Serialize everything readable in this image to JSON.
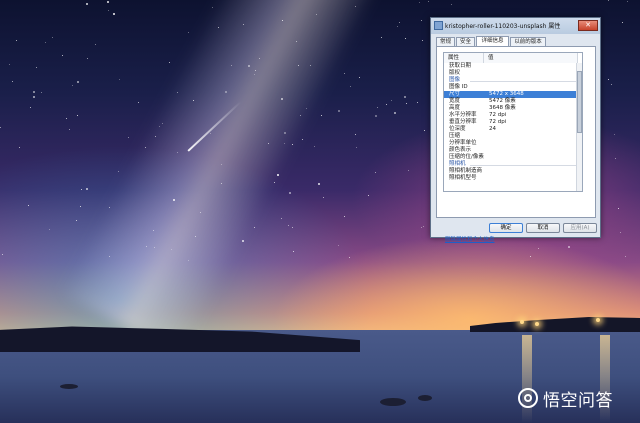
{
  "dialog": {
    "title": "kristopher-roller-110203-unsplash 属性",
    "close_label": "✕",
    "tabs": [
      {
        "label": "常规"
      },
      {
        "label": "安全"
      },
      {
        "label": "详细信息"
      },
      {
        "label": "以前的版本"
      }
    ],
    "active_tab": "详细信息",
    "columns": {
      "property": "属性",
      "value": "值"
    },
    "rows": [
      {
        "name": "获取日期",
        "value": ""
      },
      {
        "name": "版权",
        "value": ""
      },
      {
        "name": "图像",
        "value": ""
      },
      {
        "name": "图像 ID",
        "value": ""
      },
      {
        "name": "尺寸",
        "value": "5472 x 3648"
      },
      {
        "name": "宽度",
        "value": "5472 像素"
      },
      {
        "name": "高度",
        "value": "3648 像素"
      },
      {
        "name": "水平分辨率",
        "value": "72 dpi"
      },
      {
        "name": "垂直分辨率",
        "value": "72 dpi"
      },
      {
        "name": "位深度",
        "value": "24"
      },
      {
        "name": "压缩",
        "value": ""
      },
      {
        "name": "分辨率单位",
        "value": ""
      },
      {
        "name": "颜色表示",
        "value": ""
      },
      {
        "name": "压缩的位/像素",
        "value": ""
      },
      {
        "name": "照相机",
        "value": ""
      },
      {
        "name": "照相机制造商",
        "value": ""
      },
      {
        "name": "照相机型号",
        "value": ""
      }
    ],
    "section_rows": [
      "图像",
      "照相机"
    ],
    "selected_row": "尺寸",
    "remove_link": "删除属性和个人信息",
    "buttons": {
      "ok": "确定",
      "cancel": "取消",
      "apply": "应用(A)"
    }
  },
  "watermark": {
    "text": "悟空问答",
    "icon": "wukong-logo-icon"
  }
}
